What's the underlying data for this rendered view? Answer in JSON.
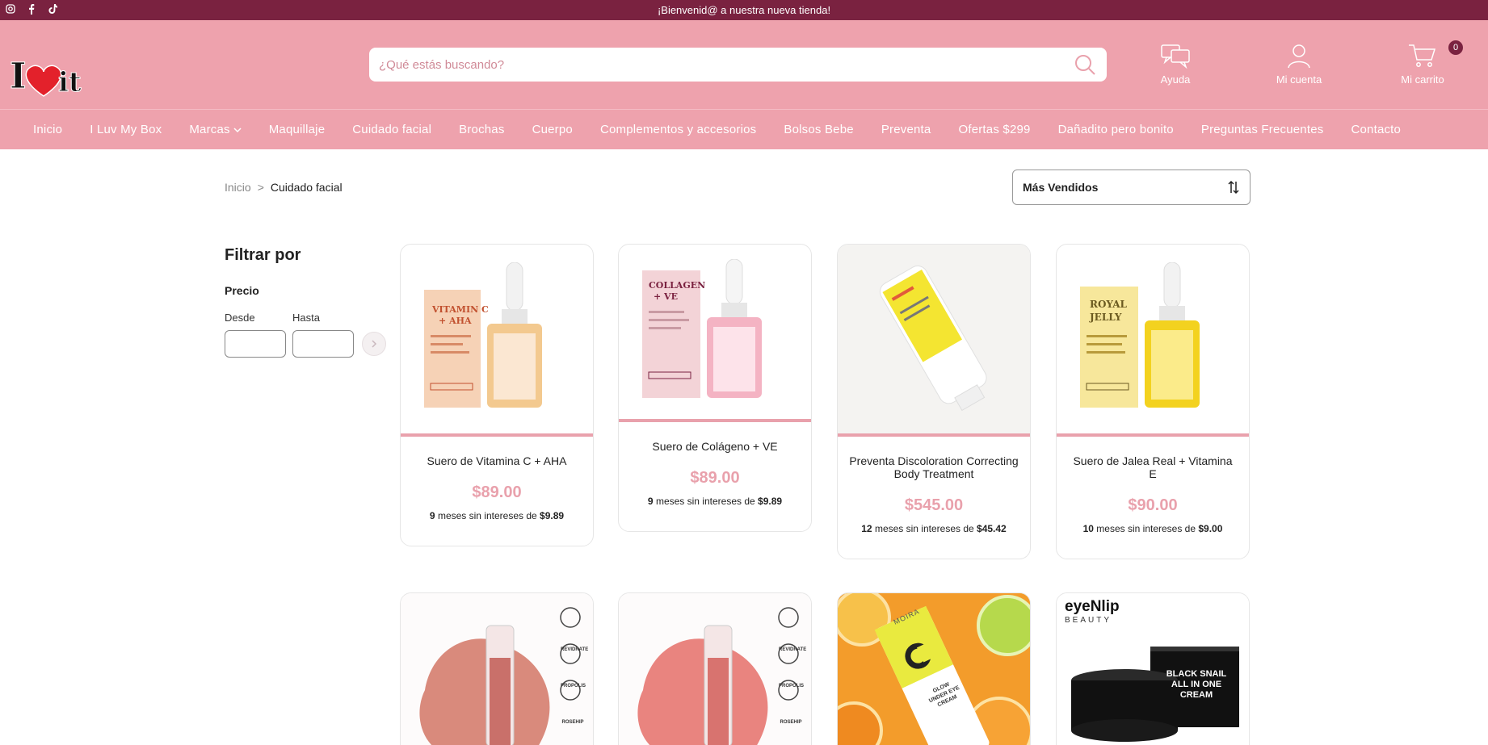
{
  "topbar": {
    "message": "¡Bienvenid@ a nuestra nueva tienda!"
  },
  "header": {
    "logo_text": "I ♥ it",
    "search_placeholder": "¿Qué estás buscando?",
    "help_label": "Ayuda",
    "account_label": "Mi cuenta",
    "cart_label": "Mi carrito",
    "cart_count": "0"
  },
  "nav": {
    "items": [
      "Inicio",
      "I Luv My Box",
      "Marcas",
      "Maquillaje",
      "Cuidado facial",
      "Brochas",
      "Cuerpo",
      "Complementos y accesorios",
      "Bolsos Bebe",
      "Preventa",
      "Ofertas $299",
      "Dañadito pero bonito",
      "Preguntas Frecuentes",
      "Contacto"
    ]
  },
  "breadcrumb": {
    "home": "Inicio",
    "separator": ">",
    "current": "Cuidado facial"
  },
  "sort": {
    "selected": "Más Vendidos"
  },
  "filters": {
    "title": "Filtrar por",
    "price_title": "Precio",
    "from_label": "Desde",
    "to_label": "Hasta"
  },
  "products": [
    {
      "name": "Suero de Vitamina C + AHA",
      "price": "$89.00",
      "months": "9",
      "msi_text": "meses sin intereses de",
      "installment": "$9.89"
    },
    {
      "name": "Suero de Colágeno + VE",
      "price": "$89.00",
      "months": "9",
      "msi_text": "meses sin intereses de",
      "installment": "$9.89"
    },
    {
      "name": "Preventa Discoloration Correcting Body Treatment",
      "price": "$545.00",
      "months": "12",
      "msi_text": "meses sin intereses de",
      "installment": "$45.42"
    },
    {
      "name": "Suero de Jalea Real + Vitamina E",
      "price": "$90.00",
      "months": "10",
      "msi_text": "meses sin intereses de",
      "installment": "$9.00"
    }
  ],
  "row2": [
    {
      "badges": [
        "REVIDRATE",
        "PROPOLIS",
        "ROSEHIP"
      ]
    },
    {
      "badges": [
        "REVIDRATE",
        "PROPOLIS",
        "ROSEHIP"
      ]
    },
    {
      "brand": "MOIRA",
      "product_text": "GLOW UNDER EYE CREAM"
    },
    {
      "brand": "eyeNlip",
      "brand_sub": "BEAUTY",
      "product_text": "BLACK SNAIL ALL IN ONE CREAM"
    }
  ],
  "colors": {
    "topbar": "#7a2240",
    "header": "#eea2ad",
    "accent": "#e9a1ac"
  }
}
